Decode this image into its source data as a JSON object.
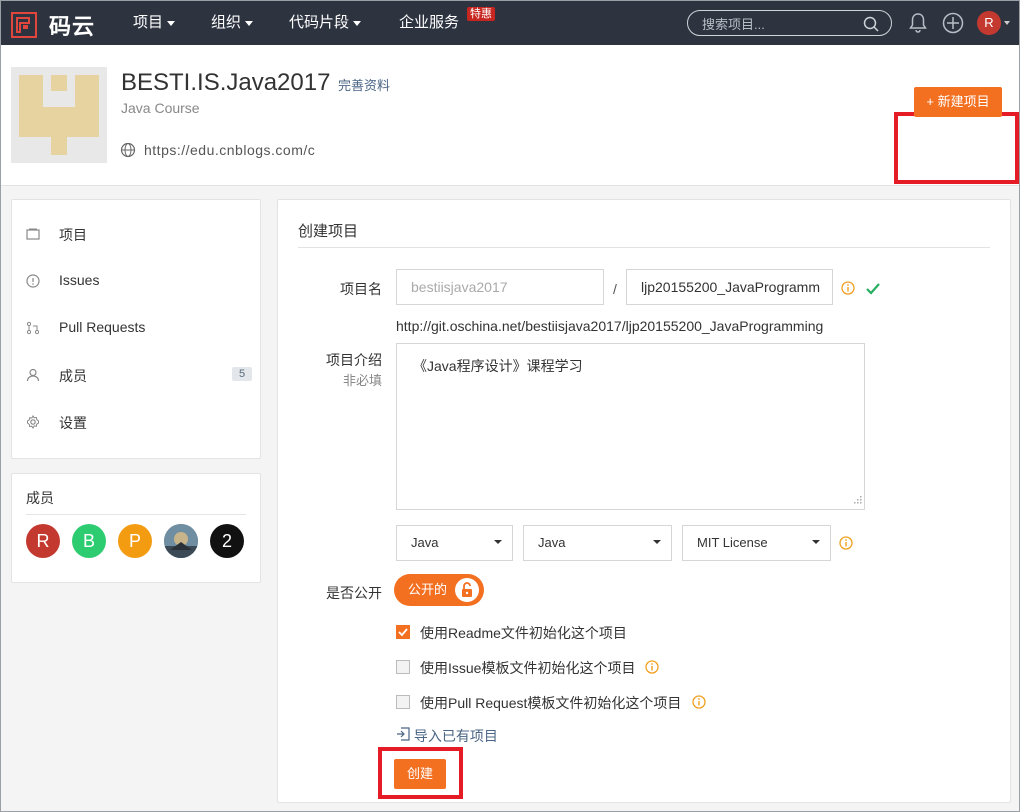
{
  "nav": {
    "brand": "码云",
    "items": [
      "项目",
      "组织",
      "代码片段",
      "企业服务"
    ],
    "hot_badge": "特惠",
    "search_placeholder": "搜索项目...",
    "avatar_letter": "R"
  },
  "org": {
    "name": "BESTI.IS.Java2017",
    "complete_profile": "完善资料",
    "subtitle": "Java Course",
    "url": "https://edu.cnblogs.com/c",
    "new_project": "+ 新建项目"
  },
  "sidebar": {
    "items": [
      {
        "label": "项目",
        "icon": "project-icon"
      },
      {
        "label": "Issues",
        "icon": "issues-icon"
      },
      {
        "label": "Pull Requests",
        "icon": "pull-request-icon"
      },
      {
        "label": "成员",
        "icon": "members-icon"
      },
      {
        "label": "设置",
        "icon": "settings-icon"
      }
    ],
    "member_count": "5"
  },
  "members": {
    "title": "成员",
    "avatars": [
      {
        "letter": "R",
        "color": "#c4392f"
      },
      {
        "letter": "B",
        "color": "#2ecc71"
      },
      {
        "letter": "P",
        "color": "#f39c12"
      },
      {
        "letter": "",
        "color": "#5d7a8c"
      },
      {
        "letter": "2",
        "color": "#111111"
      }
    ]
  },
  "form": {
    "title": "创建项目",
    "name_label": "项目名",
    "namespace_value": "bestiisjava2017",
    "project_name_value": "ljp20155200_JavaProgramm",
    "url_preview": "http://git.oschina.net/bestiisjava2017/ljp20155200_JavaProgramming",
    "intro_label": "项目介绍",
    "intro_optional": "非必填",
    "intro_value": "《Java程序设计》课程学习",
    "language": "Java",
    "gitignore": "Java",
    "license": "MIT License",
    "public_label": "是否公开",
    "public_toggle": "公开的",
    "checkboxes": [
      {
        "label": "使用Readme文件初始化这个项目",
        "checked": true
      },
      {
        "label": "使用Issue模板文件初始化这个项目",
        "checked": false
      },
      {
        "label": "使用Pull Request模板文件初始化这个项目",
        "checked": false
      }
    ],
    "import_link": "导入已有项目",
    "create_button": "创建"
  },
  "colors": {
    "accent": "#f37021",
    "nav_bg": "#2d3440",
    "highlight": "#e51c25",
    "link": "#4a6585",
    "success": "#27ae60"
  }
}
